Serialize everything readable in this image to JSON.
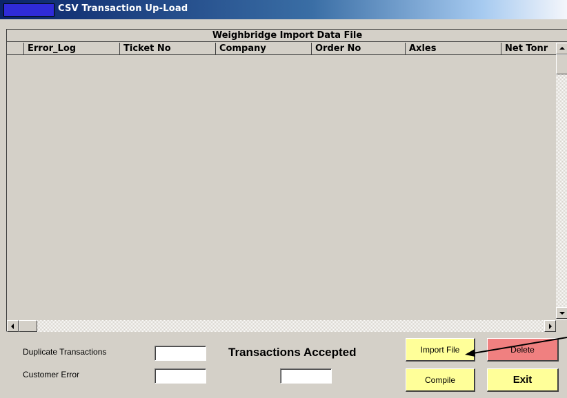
{
  "window": {
    "title": "CSV Transaction Up-Load"
  },
  "grid": {
    "caption": "Weighbridge  Import Data File",
    "columns": [
      "Error_Log",
      "Ticket No",
      "Company",
      "Order No",
      "Axles",
      "Net Tonr"
    ]
  },
  "stats": {
    "duplicate_label": "Duplicate Transactions",
    "customer_error_label": "Customer Error",
    "accepted_label": "Transactions Accepted"
  },
  "buttons": {
    "import_file": "Import File",
    "delete": "Delete",
    "compile": "Compile",
    "exit": "Exit"
  },
  "colors": {
    "import_button": "#ffff99",
    "compile_button": "#ffff99",
    "exit_button": "#ffff99",
    "delete_button": "#f08080",
    "title_square": "#2f2bd8"
  }
}
